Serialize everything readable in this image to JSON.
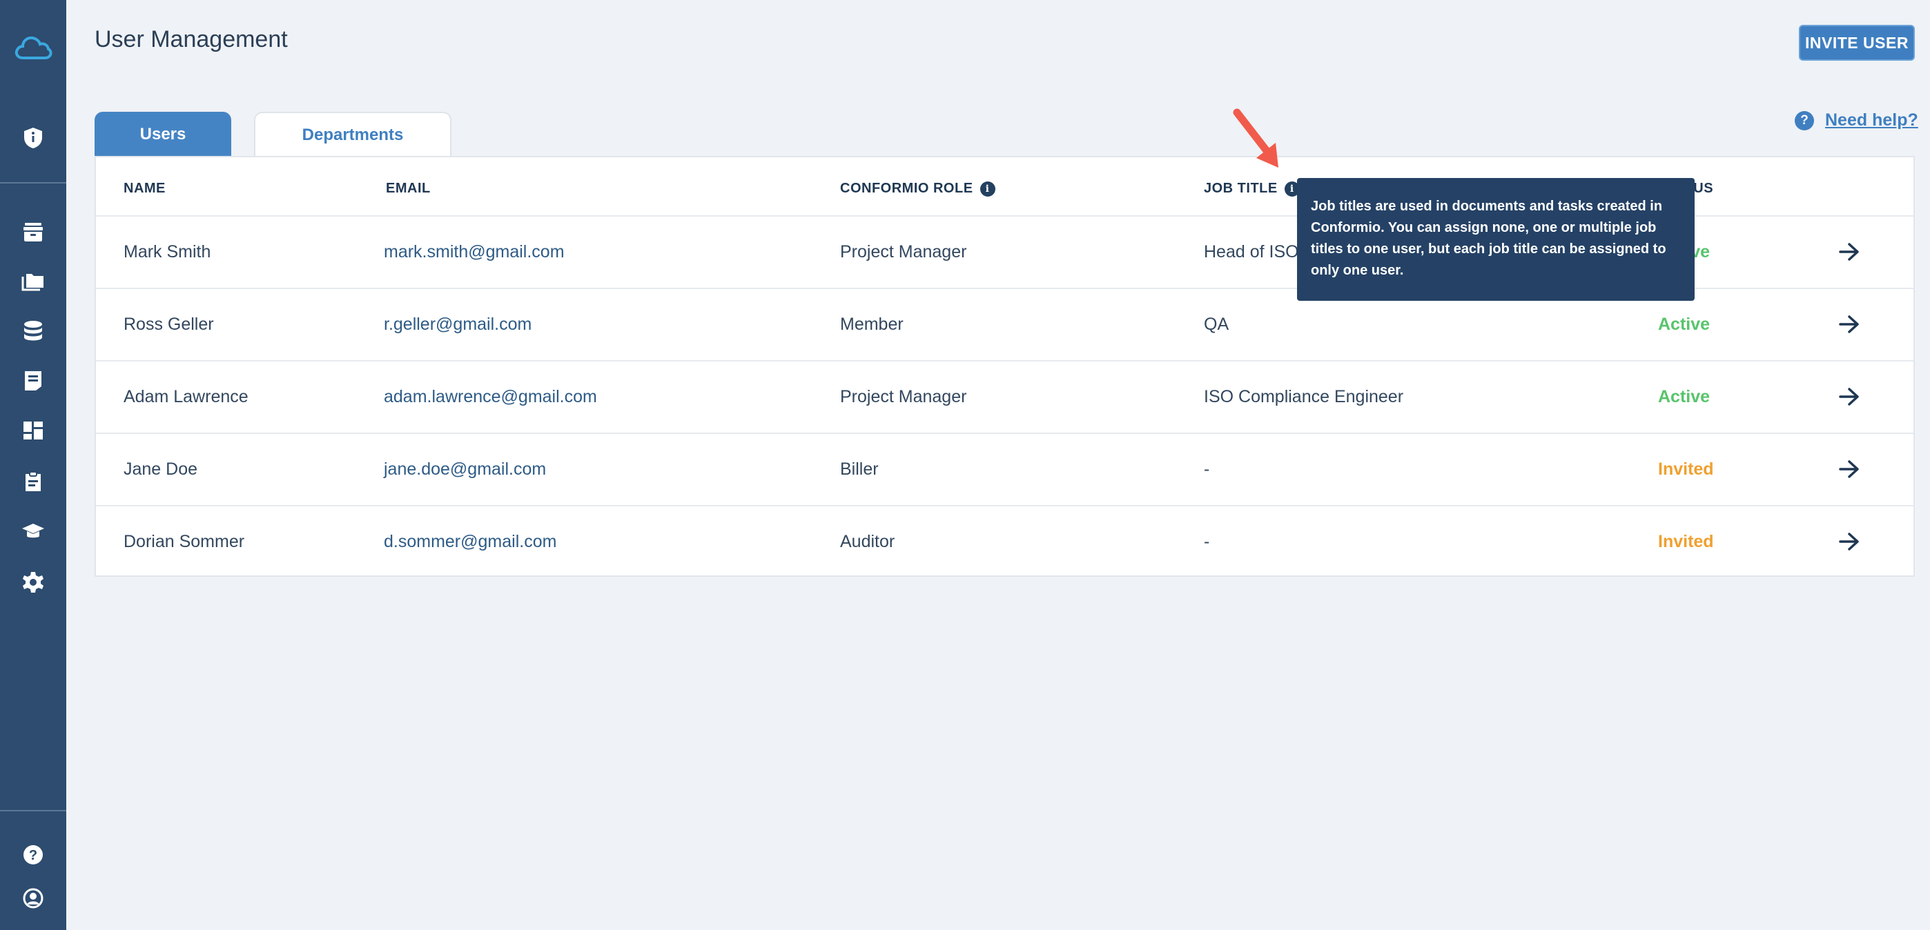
{
  "header": {
    "title": "User Management",
    "invite_label": "INVITE USER"
  },
  "tabs": [
    {
      "label": "Users",
      "active": true
    },
    {
      "label": "Departments",
      "active": false
    }
  ],
  "help": {
    "label": "Need help?",
    "icon": "question-icon"
  },
  "sidebar": {
    "top_icon": "cloud-logo-icon",
    "items": [
      "shield-icon",
      "archive-icon",
      "folders-icon",
      "database-icon",
      "document-icon",
      "dashboard-icon",
      "clipboard-icon",
      "graduation-cap-icon",
      "gear-icon"
    ],
    "bottom_items": [
      "help-icon",
      "user-account-icon"
    ]
  },
  "table": {
    "columns": [
      "NAME",
      "EMAIL",
      "CONFORMIO ROLE",
      "JOB TITLE",
      "STATUS"
    ],
    "rows": [
      {
        "name": "Mark Smith",
        "email": "mark.smith@gmail.com",
        "role": "Project Manager",
        "job_title": "Head of ISO",
        "status": "Active"
      },
      {
        "name": "Ross Geller",
        "email": "r.geller@gmail.com",
        "role": "Member",
        "job_title": "QA",
        "status": "Active"
      },
      {
        "name": "Adam Lawrence",
        "email": "adam.lawrence@gmail.com",
        "role": "Project Manager",
        "job_title": "ISO Compliance Engineer",
        "status": "Active"
      },
      {
        "name": "Jane Doe",
        "email": "jane.doe@gmail.com",
        "role": "Biller",
        "job_title": "-",
        "status": "Invited"
      },
      {
        "name": "Dorian Sommer",
        "email": "d.sommer@gmail.com",
        "role": "Auditor",
        "job_title": "-",
        "status": "Invited"
      }
    ]
  },
  "tooltip": {
    "text": "Job titles are used in documents and tasks created in Conformio. You can assign none, one or multiple job titles to one user, but each job title can be assigned to only one user."
  },
  "colors": {
    "sidebar": "#2d4c6f",
    "accent": "#3f7fc1",
    "active": "#58c46c",
    "invited": "#f0a030",
    "tooltip": "#254266",
    "pointer": "#f15b4b"
  }
}
